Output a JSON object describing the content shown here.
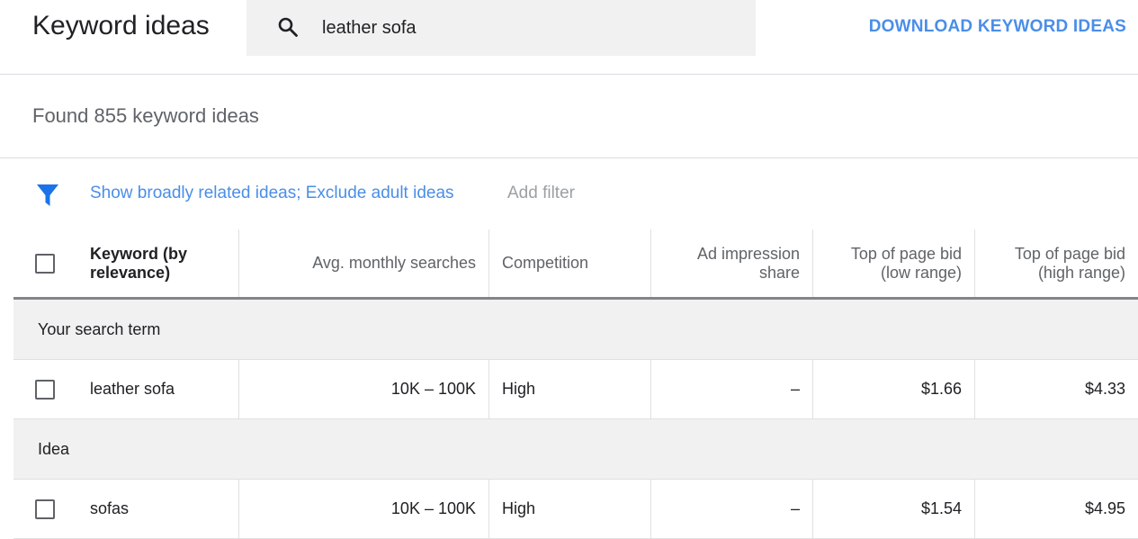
{
  "header": {
    "title": "Keyword ideas",
    "search_value": "leather sofa",
    "download_label": "DOWNLOAD KEYWORD IDEAS"
  },
  "summary": {
    "found_text": "Found 855 keyword ideas"
  },
  "filters": {
    "active_text": "Show broadly related ideas; Exclude adult ideas",
    "add_label": "Add filter"
  },
  "table": {
    "headers": {
      "keyword_line1": "Keyword (by",
      "keyword_line2": "relevance)",
      "avg": "Avg. monthly searches",
      "competition": "Competition",
      "impression_line1": "Ad impression",
      "impression_line2": "share",
      "low_line1": "Top of page bid",
      "low_line2": "(low range)",
      "high_line1": "Top of page bid",
      "high_line2": "(high range)"
    },
    "groups": [
      {
        "label": "Your search term",
        "rows": [
          {
            "keyword": "leather sofa",
            "avg": "10K – 100K",
            "competition": "High",
            "impression": "–",
            "low": "$1.66",
            "high": "$4.33"
          }
        ]
      },
      {
        "label": "Idea",
        "rows": [
          {
            "keyword": "sofas",
            "avg": "10K – 100K",
            "competition": "High",
            "impression": "–",
            "low": "$1.54",
            "high": "$4.95"
          }
        ]
      }
    ]
  },
  "colors": {
    "accent": "#4a8ee8",
    "muted": "#9aa0a6",
    "filter_icon": "#1a73e8"
  },
  "icons": {
    "search": "search-icon",
    "filter": "filter-icon",
    "checkbox": "checkbox-icon"
  }
}
